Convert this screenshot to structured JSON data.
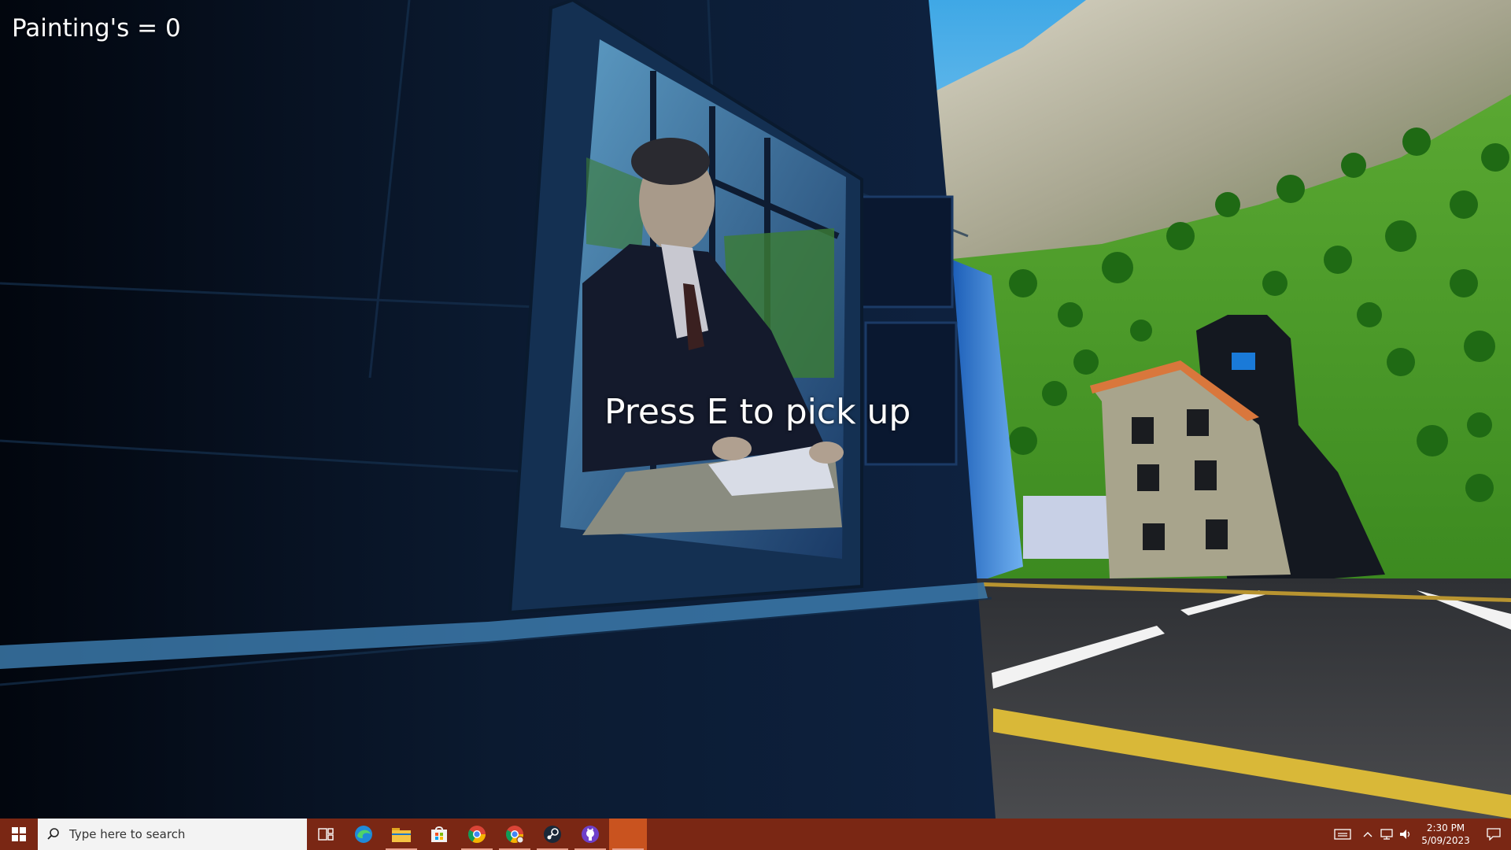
{
  "hud": {
    "painting_counter": "Painting's = 0",
    "interaction_prompt": "Press E to pick up"
  },
  "taskbar": {
    "search_placeholder": "Type here to search",
    "pinned_apps": [
      {
        "name": "task-view-icon"
      },
      {
        "name": "edge-browser-icon"
      },
      {
        "name": "file-explorer-icon"
      },
      {
        "name": "microsoft-store-icon"
      },
      {
        "name": "chrome-browser-icon"
      },
      {
        "name": "chrome-profile-icon"
      },
      {
        "name": "steam-icon"
      },
      {
        "name": "github-desktop-icon"
      },
      {
        "name": "running-app-icon"
      }
    ],
    "clock_time": "2:30 PM",
    "clock_date": "5/09/2023",
    "colors": {
      "taskbar_bg": "#7a2714",
      "active_app_bg": "#c9531f"
    }
  }
}
